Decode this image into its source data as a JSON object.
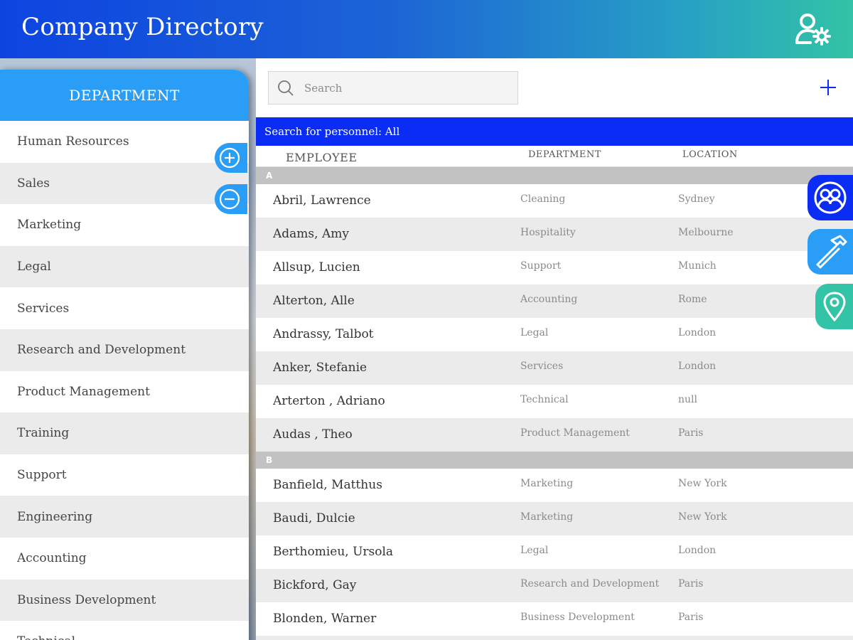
{
  "header": {
    "title": "Company Directory",
    "user_settings_icon": "user-settings-icon"
  },
  "sidebar": {
    "title": "DEPARTMENT",
    "items": [
      {
        "label": "Human Resources"
      },
      {
        "label": "Sales"
      },
      {
        "label": "Marketing"
      },
      {
        "label": "Legal"
      },
      {
        "label": "Services"
      },
      {
        "label": "Research and Development"
      },
      {
        "label": "Product Management"
      },
      {
        "label": "Training"
      },
      {
        "label": "Support"
      },
      {
        "label": "Engineering"
      },
      {
        "label": "Accounting"
      },
      {
        "label": "Business Development"
      },
      {
        "label": "Technical"
      }
    ],
    "add_icon": "plus-circle-icon",
    "remove_icon": "minus-circle-icon"
  },
  "search": {
    "placeholder": "Search",
    "value": ""
  },
  "personnel_bar": {
    "text": "Search for personnel: All"
  },
  "columns": {
    "employee": "EMPLOYEE",
    "department": "DEPARTMENT",
    "location": "LOCATION"
  },
  "sections": [
    {
      "letter": "A",
      "rows": [
        {
          "name": "Abril, Lawrence",
          "department": "Cleaning",
          "location": "Sydney"
        },
        {
          "name": "Adams, Amy",
          "department": "Hospitality",
          "location": "Melbourne"
        },
        {
          "name": "Allsup, Lucien",
          "department": "Support",
          "location": "Munich"
        },
        {
          "name": "Alterton, Alle",
          "department": "Accounting",
          "location": "Rome"
        },
        {
          "name": "Andrassy, Talbot",
          "department": "Legal",
          "location": "London"
        },
        {
          "name": "Anker, Stefanie",
          "department": "Services",
          "location": "London"
        },
        {
          "name": "Arterton , Adriano",
          "department": "Technical",
          "location": "null"
        },
        {
          "name": "Audas , Theo",
          "department": "Product Management",
          "location": "Paris"
        }
      ]
    },
    {
      "letter": "B",
      "rows": [
        {
          "name": "Banfield, Matthus",
          "department": "Marketing",
          "location": "New York"
        },
        {
          "name": "Baudi, Dulcie",
          "department": "Marketing",
          "location": "New York"
        },
        {
          "name": "Berthomieu, Ursola",
          "department": "Legal",
          "location": "London"
        },
        {
          "name": "Bickford, Gay",
          "department": "Research and Development",
          "location": "Paris"
        },
        {
          "name": "Blonden, Warner",
          "department": "Business Development",
          "location": "Paris"
        }
      ]
    }
  ],
  "side_buttons": {
    "personnel_icon": "people-icon",
    "tools_icon": "hammer-icon",
    "location_icon": "map-pin-icon"
  },
  "colors": {
    "header_start": "#0d44e0",
    "header_end": "#33c3a6",
    "sidebar_accent": "#2a9df7",
    "personnel_bar": "#0a2cf5",
    "location_green": "#33c3a6"
  }
}
